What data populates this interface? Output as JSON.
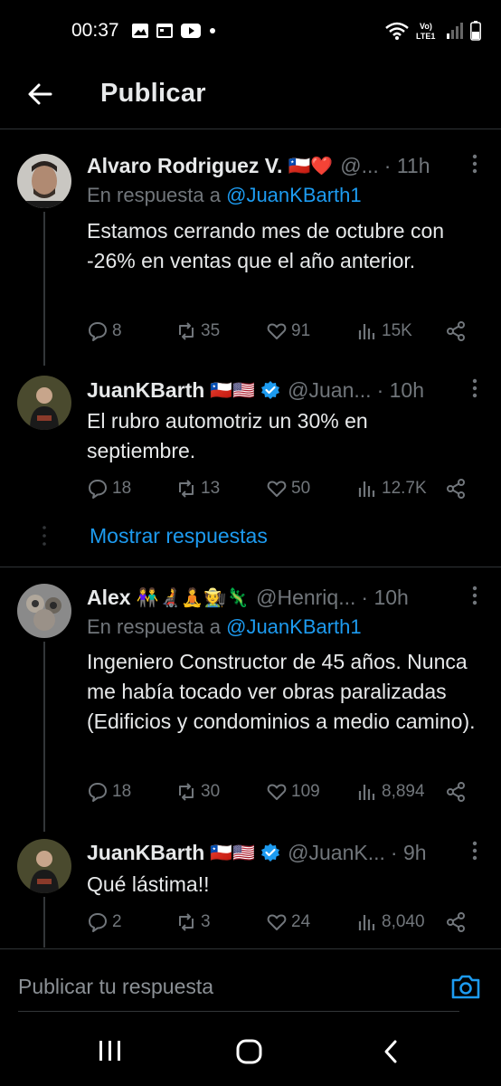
{
  "status_bar": {
    "time": "00:37"
  },
  "header": {
    "title": "Publicar"
  },
  "tweets": [
    {
      "name": "Alvaro Rodriguez V.",
      "flags": "🇨🇱❤️",
      "handle": "@...",
      "time": "· 11h",
      "reply_prefix": "En respuesta a ",
      "reply_mention": "@JuanKBarth1",
      "text": "Estamos cerrando mes de octubre con -26% en ventas que el año anterior.",
      "replies": "8",
      "retweets": "35",
      "likes": "91",
      "views": "15K"
    },
    {
      "name": "JuanKBarth",
      "flags": "🇨🇱🇺🇸",
      "handle": "@Juan...",
      "time": "· 10h",
      "text": "El rubro automotriz un 30% en septiembre.",
      "replies": "18",
      "retweets": "13",
      "likes": "50",
      "views": "12.7K"
    },
    {
      "name": "Alex",
      "flags": "👫🧑‍🦼🧘🧑‍🌾🦎",
      "handle": "@Henriq...",
      "time": "· 10h",
      "reply_prefix": "En respuesta a ",
      "reply_mention": "@JuanKBarth1",
      "text": "Ingeniero Constructor de 45 años. Nunca me había tocado ver obras paralizadas (Edificios y condominios a medio camino).",
      "replies": "18",
      "retweets": "30",
      "likes": "109",
      "views": "8,894"
    },
    {
      "name": "JuanKBarth",
      "flags": "🇨🇱🇺🇸",
      "handle": "@JuanK...",
      "time": "· 9h",
      "text": "Qué lástima!!",
      "replies": "2",
      "retweets": "3",
      "likes": "24",
      "views": "8,040"
    }
  ],
  "show_replies_label": "Mostrar respuestas",
  "compose": {
    "placeholder": "Publicar tu respuesta"
  },
  "colors": {
    "accent": "#1d9bf0",
    "background": "#000000",
    "muted": "#71767b",
    "verified": "#1d9bf0"
  }
}
